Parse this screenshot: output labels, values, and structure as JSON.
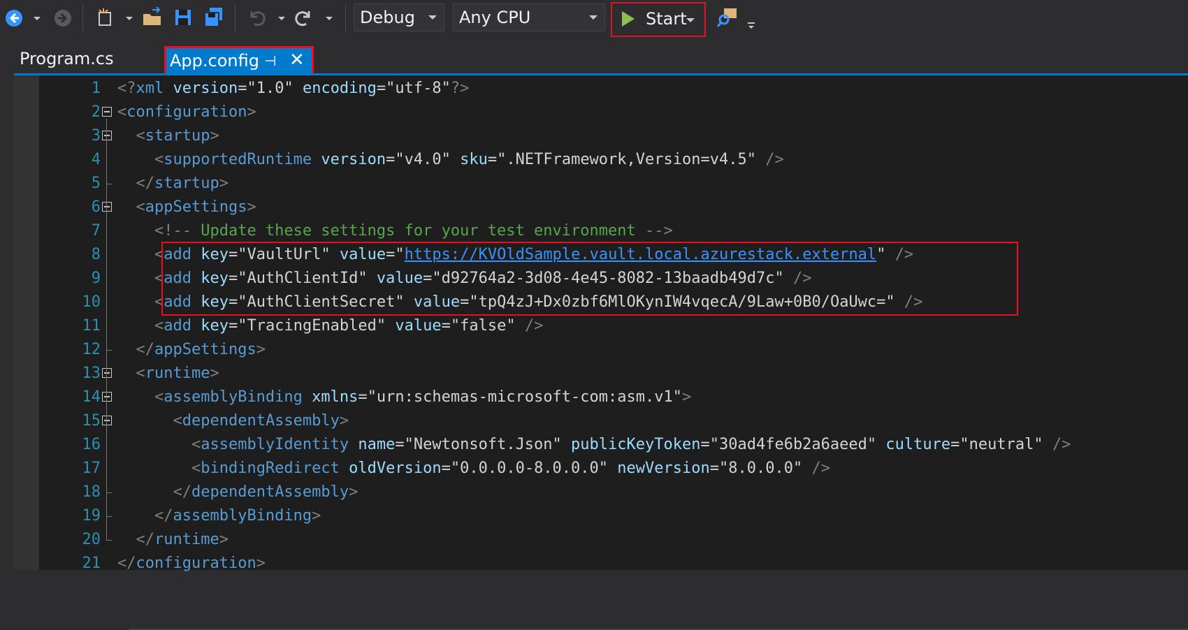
{
  "toolbar": {
    "config": "Debug",
    "platform": "Any CPU",
    "start_label": "Start",
    "icons": [
      "back-arrow-icon",
      "forward-arrow-icon",
      "new-project-icon",
      "open-folder-icon",
      "save-icon",
      "save-all-icon",
      "undo-icon",
      "redo-icon",
      "find-in-files-icon"
    ]
  },
  "tabs": {
    "inactive": "Program.cs",
    "active": "App.config",
    "pin_glyph": "⊣",
    "close_glyph": "✕"
  },
  "editor": {
    "highlight_lines": [
      8,
      10
    ],
    "lines": [
      {
        "n": "1",
        "parts": [
          [
            "p",
            "<?"
          ],
          [
            "e",
            "xml"
          ],
          [
            "v",
            " "
          ],
          [
            "a",
            "version"
          ],
          [
            "eq",
            "="
          ],
          [
            "q",
            "\"1.0\""
          ],
          [
            "v",
            " "
          ],
          [
            "a",
            "encoding"
          ],
          [
            "eq",
            "="
          ],
          [
            "q",
            "\"utf-8\""
          ],
          [
            "p",
            "?>"
          ]
        ]
      },
      {
        "n": "2",
        "parts": [
          [
            "p",
            "<"
          ],
          [
            "e",
            "configuration"
          ],
          [
            "p",
            ">"
          ]
        ]
      },
      {
        "n": "3",
        "parts": [
          [
            "v",
            "  "
          ],
          [
            "p",
            "<"
          ],
          [
            "e",
            "startup"
          ],
          [
            "p",
            ">"
          ]
        ]
      },
      {
        "n": "4",
        "parts": [
          [
            "v",
            "    "
          ],
          [
            "p",
            "<"
          ],
          [
            "e",
            "supportedRuntime"
          ],
          [
            "v",
            " "
          ],
          [
            "a",
            "version"
          ],
          [
            "eq",
            "="
          ],
          [
            "q",
            "\"v4.0\""
          ],
          [
            "v",
            " "
          ],
          [
            "a",
            "sku"
          ],
          [
            "eq",
            "="
          ],
          [
            "q",
            "\".NETFramework,Version=v4.5\""
          ],
          [
            "v",
            " "
          ],
          [
            "p",
            "/>"
          ]
        ]
      },
      {
        "n": "5",
        "parts": [
          [
            "v",
            "  "
          ],
          [
            "p",
            "</"
          ],
          [
            "e",
            "startup"
          ],
          [
            "p",
            ">"
          ]
        ]
      },
      {
        "n": "6",
        "parts": [
          [
            "v",
            "  "
          ],
          [
            "p",
            "<"
          ],
          [
            "e",
            "appSettings"
          ],
          [
            "p",
            ">"
          ]
        ]
      },
      {
        "n": "7",
        "parts": [
          [
            "v",
            "    "
          ],
          [
            "p",
            "<!--"
          ],
          [
            "c",
            " Update these settings for your test environment "
          ],
          [
            "p",
            "-->"
          ]
        ]
      },
      {
        "n": "8",
        "parts": [
          [
            "v",
            "    "
          ],
          [
            "p",
            "<"
          ],
          [
            "e",
            "add"
          ],
          [
            "v",
            " "
          ],
          [
            "a",
            "key"
          ],
          [
            "eq",
            "="
          ],
          [
            "q",
            "\"VaultUrl\""
          ],
          [
            "v",
            " "
          ],
          [
            "a",
            "value"
          ],
          [
            "eq",
            "="
          ],
          [
            "q",
            "\""
          ],
          [
            "u",
            "https://KVOldSample.vault.local.azurestack.external"
          ],
          [
            "q",
            "\""
          ],
          [
            "v",
            " "
          ],
          [
            "p",
            "/>"
          ]
        ]
      },
      {
        "n": "9",
        "parts": [
          [
            "v",
            "    "
          ],
          [
            "p",
            "<"
          ],
          [
            "e",
            "add"
          ],
          [
            "v",
            " "
          ],
          [
            "a",
            "key"
          ],
          [
            "eq",
            "="
          ],
          [
            "q",
            "\"AuthClientId\""
          ],
          [
            "v",
            " "
          ],
          [
            "a",
            "value"
          ],
          [
            "eq",
            "="
          ],
          [
            "q",
            "\"d92764a2-3d08-4e45-8082-13baadb49d7c\""
          ],
          [
            "v",
            " "
          ],
          [
            "p",
            "/>"
          ]
        ]
      },
      {
        "n": "10",
        "parts": [
          [
            "v",
            "    "
          ],
          [
            "p",
            "<"
          ],
          [
            "e",
            "add"
          ],
          [
            "v",
            " "
          ],
          [
            "a",
            "key"
          ],
          [
            "eq",
            "="
          ],
          [
            "q",
            "\"AuthClientSecret\""
          ],
          [
            "v",
            " "
          ],
          [
            "a",
            "value"
          ],
          [
            "eq",
            "="
          ],
          [
            "q",
            "\"tpQ4zJ+Dx0zbf6MlOKynIW4vqecA/9Law+0B0/OaUwc=\""
          ],
          [
            "v",
            " "
          ],
          [
            "p",
            "/>"
          ]
        ]
      },
      {
        "n": "11",
        "parts": [
          [
            "v",
            "    "
          ],
          [
            "p",
            "<"
          ],
          [
            "e",
            "add"
          ],
          [
            "v",
            " "
          ],
          [
            "a",
            "key"
          ],
          [
            "eq",
            "="
          ],
          [
            "q",
            "\"TracingEnabled\""
          ],
          [
            "v",
            " "
          ],
          [
            "a",
            "value"
          ],
          [
            "eq",
            "="
          ],
          [
            "q",
            "\"false\""
          ],
          [
            "v",
            " "
          ],
          [
            "p",
            "/>"
          ]
        ]
      },
      {
        "n": "12",
        "parts": [
          [
            "v",
            "  "
          ],
          [
            "p",
            "</"
          ],
          [
            "e",
            "appSettings"
          ],
          [
            "p",
            ">"
          ]
        ]
      },
      {
        "n": "13",
        "parts": [
          [
            "v",
            "  "
          ],
          [
            "p",
            "<"
          ],
          [
            "e",
            "runtime"
          ],
          [
            "p",
            ">"
          ]
        ]
      },
      {
        "n": "14",
        "parts": [
          [
            "v",
            "    "
          ],
          [
            "p",
            "<"
          ],
          [
            "e",
            "assemblyBinding"
          ],
          [
            "v",
            " "
          ],
          [
            "a",
            "xmlns"
          ],
          [
            "eq",
            "="
          ],
          [
            "q",
            "\"urn:schemas-microsoft-com:asm.v1\""
          ],
          [
            "p",
            ">"
          ]
        ]
      },
      {
        "n": "15",
        "parts": [
          [
            "v",
            "      "
          ],
          [
            "p",
            "<"
          ],
          [
            "e",
            "dependentAssembly"
          ],
          [
            "p",
            ">"
          ]
        ]
      },
      {
        "n": "16",
        "parts": [
          [
            "v",
            "        "
          ],
          [
            "p",
            "<"
          ],
          [
            "e",
            "assemblyIdentity"
          ],
          [
            "v",
            " "
          ],
          [
            "a",
            "name"
          ],
          [
            "eq",
            "="
          ],
          [
            "q",
            "\"Newtonsoft.Json\""
          ],
          [
            "v",
            " "
          ],
          [
            "a",
            "publicKeyToken"
          ],
          [
            "eq",
            "="
          ],
          [
            "q",
            "\"30ad4fe6b2a6aeed\""
          ],
          [
            "v",
            " "
          ],
          [
            "a",
            "culture"
          ],
          [
            "eq",
            "="
          ],
          [
            "q",
            "\"neutral\""
          ],
          [
            "v",
            " "
          ],
          [
            "p",
            "/>"
          ]
        ]
      },
      {
        "n": "17",
        "parts": [
          [
            "v",
            "        "
          ],
          [
            "p",
            "<"
          ],
          [
            "e",
            "bindingRedirect"
          ],
          [
            "v",
            " "
          ],
          [
            "a",
            "oldVersion"
          ],
          [
            "eq",
            "="
          ],
          [
            "q",
            "\"0.0.0.0-8.0.0.0\""
          ],
          [
            "v",
            " "
          ],
          [
            "a",
            "newVersion"
          ],
          [
            "eq",
            "="
          ],
          [
            "q",
            "\"8.0.0.0\""
          ],
          [
            "v",
            " "
          ],
          [
            "p",
            "/>"
          ]
        ]
      },
      {
        "n": "18",
        "parts": [
          [
            "v",
            "      "
          ],
          [
            "p",
            "</"
          ],
          [
            "e",
            "dependentAssembly"
          ],
          [
            "p",
            ">"
          ]
        ]
      },
      {
        "n": "19",
        "parts": [
          [
            "v",
            "    "
          ],
          [
            "p",
            "</"
          ],
          [
            "e",
            "assemblyBinding"
          ],
          [
            "p",
            ">"
          ]
        ]
      },
      {
        "n": "20",
        "parts": [
          [
            "v",
            "  "
          ],
          [
            "p",
            "</"
          ],
          [
            "e",
            "runtime"
          ],
          [
            "p",
            ">"
          ]
        ]
      },
      {
        "n": "21",
        "parts": [
          [
            "p",
            "</"
          ],
          [
            "e",
            "configuration"
          ],
          [
            "p",
            ">"
          ]
        ]
      }
    ]
  }
}
